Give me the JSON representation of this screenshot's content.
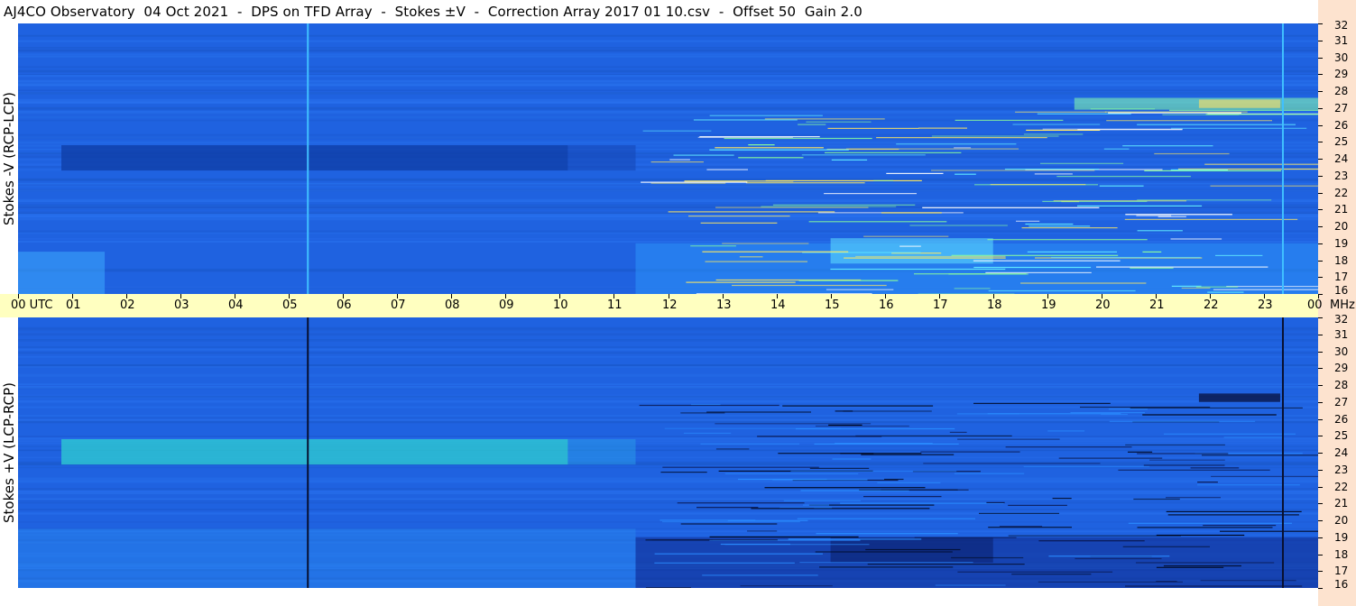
{
  "header": {
    "title": "AJ4CO Observatory  04 Oct 2021  -  DPS on TFD Array  -  Stokes ±V  -  Correction Array 2017 01 10.csv  -  Offset 50  Gain 2.0"
  },
  "chart_data": [
    {
      "type": "heatmap",
      "panel": "top",
      "ylabel": "Stokes -V (RCP-LCP)",
      "x_ticks": [
        "00 UTC",
        "01",
        "02",
        "03",
        "04",
        "05",
        "06",
        "07",
        "08",
        "09",
        "10",
        "11",
        "12",
        "13",
        "14",
        "15",
        "16",
        "17",
        "18",
        "19",
        "20",
        "21",
        "22",
        "23",
        "00"
      ],
      "y_ticks": [
        "16",
        "17",
        "18",
        "19",
        "20",
        "21",
        "22",
        "23",
        "24",
        "25",
        "26",
        "27",
        "28",
        "29",
        "30",
        "31",
        "32"
      ],
      "xlim": [
        0,
        24
      ],
      "ylim": [
        16,
        32
      ],
      "y_unit": "MHz",
      "base_color": "#1f62e0",
      "bands": [
        {
          "t0": 0.8,
          "t1": 10.15,
          "f0": 23.3,
          "f1": 24.8,
          "color": "#0f3fa8",
          "strength": 0.8
        },
        {
          "t0": 10.15,
          "t1": 11.4,
          "f0": 23.3,
          "f1": 24.8,
          "color": "#1648b8",
          "strength": 0.6
        },
        {
          "t0": 0.0,
          "t1": 1.6,
          "f0": 16.0,
          "f1": 18.5,
          "color": "#3fb0ff",
          "strength": 0.5
        },
        {
          "t0": 11.4,
          "t1": 24.0,
          "f0": 16.0,
          "f1": 19.0,
          "color": "#2ea0ff",
          "strength": 0.45
        },
        {
          "t0": 15.0,
          "t1": 18.0,
          "f0": 17.8,
          "f1": 19.3,
          "color": "#5fe0ff",
          "strength": 0.55
        },
        {
          "t0": 19.5,
          "t1": 24.0,
          "f0": 26.9,
          "f1": 27.6,
          "color": "#88ffaa",
          "strength": 0.55
        },
        {
          "t0": 21.8,
          "t1": 23.3,
          "f0": 27.0,
          "f1": 27.5,
          "color": "#ffe060",
          "strength": 0.6
        }
      ],
      "lines": [
        {
          "t": 5.35,
          "color": "#40c0ff"
        },
        {
          "t": 23.35,
          "color": "#40c0ff"
        }
      ]
    },
    {
      "type": "heatmap",
      "panel": "bottom",
      "ylabel": "Stokes +V (LCP-RCP)",
      "x_ticks": [
        "00 UTC",
        "01",
        "02",
        "03",
        "04",
        "05",
        "06",
        "07",
        "08",
        "09",
        "10",
        "11",
        "12",
        "13",
        "14",
        "15",
        "16",
        "17",
        "18",
        "19",
        "20",
        "21",
        "22",
        "23",
        "00"
      ],
      "y_ticks": [
        "16",
        "17",
        "18",
        "19",
        "20",
        "21",
        "22",
        "23",
        "24",
        "25",
        "26",
        "27",
        "28",
        "29",
        "30",
        "31",
        "32"
      ],
      "xlim": [
        0,
        24
      ],
      "ylim": [
        16,
        32
      ],
      "y_unit": "MHz",
      "base_color": "#1f62e0",
      "bands": [
        {
          "t0": 0.8,
          "t1": 10.15,
          "f0": 23.3,
          "f1": 24.8,
          "color": "#2fd0d0",
          "strength": 0.75
        },
        {
          "t0": 10.15,
          "t1": 11.4,
          "f0": 23.3,
          "f1": 24.8,
          "color": "#2a9ee8",
          "strength": 0.5
        },
        {
          "t0": 0.0,
          "t1": 11.4,
          "f0": 16.0,
          "f1": 19.5,
          "color": "#2a8ef0",
          "strength": 0.4
        },
        {
          "t0": 11.4,
          "t1": 24.0,
          "f0": 16.0,
          "f1": 19.0,
          "color": "#0e2a8c",
          "strength": 0.55
        },
        {
          "t0": 15.0,
          "t1": 18.0,
          "f0": 17.5,
          "f1": 19.0,
          "color": "#081a60",
          "strength": 0.5
        },
        {
          "t0": 21.8,
          "t1": 23.3,
          "f0": 27.0,
          "f1": 27.5,
          "color": "#050a30",
          "strength": 0.7
        }
      ],
      "lines": [
        {
          "t": 5.35,
          "color": "#081030"
        },
        {
          "t": 23.35,
          "color": "#081030"
        }
      ]
    }
  ]
}
